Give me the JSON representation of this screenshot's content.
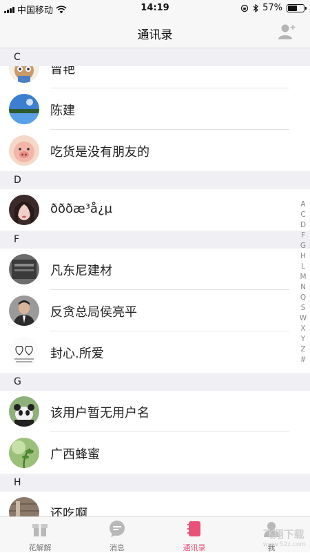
{
  "status_bar": {
    "carrier": "中国移动",
    "time": "14:19",
    "battery": "57%",
    "battery_level": 0.57
  },
  "nav": {
    "title": "通讯录",
    "add_friend_icon": "add-user-icon"
  },
  "sections": [
    {
      "letter": "C",
      "contacts": [
        {
          "name": "曾艳",
          "avatar": "cartoon-monkey"
        },
        {
          "name": "陈建",
          "avatar": "lake-landscape"
        },
        {
          "name": "吃货是没有朋友的",
          "avatar": "cartoon-pig"
        }
      ]
    },
    {
      "letter": "D",
      "contacts": [
        {
          "name": "ðððæ³å¿µ",
          "avatar": "girl-portrait"
        }
      ]
    },
    {
      "letter": "F",
      "contacts": [
        {
          "name": "凡东尼建材",
          "avatar": "dark-building"
        },
        {
          "name": "反贪总局侯亮平",
          "avatar": "man-portrait"
        },
        {
          "name": "封心.所爱",
          "avatar": "sketch-hearts"
        }
      ]
    },
    {
      "letter": "G",
      "contacts": [
        {
          "name": "该用户暂无用户名",
          "avatar": "panda"
        },
        {
          "name": "广西蜂蜜",
          "avatar": "green-plant"
        }
      ]
    },
    {
      "letter": "H",
      "contacts": [
        {
          "name": "还吃啊",
          "avatar": "wood-texture"
        }
      ]
    }
  ],
  "index_letters": [
    "A",
    "C",
    "D",
    "F",
    "G",
    "H",
    "L",
    "M",
    "N",
    "Q",
    "S",
    "W",
    "X",
    "Y",
    "Z",
    "#"
  ],
  "tabs": [
    {
      "label": "花解解",
      "icon": "gift-icon",
      "active": false
    },
    {
      "label": "消息",
      "icon": "chat-bubble-icon",
      "active": false
    },
    {
      "label": "通讯录",
      "icon": "contacts-book-icon",
      "active": true
    },
    {
      "label": "我",
      "icon": "profile-icon",
      "active": false
    }
  ],
  "colors": {
    "accent": "#e8517a",
    "section_bg": "#efeff4",
    "bar_bg": "#f7f7f7"
  },
  "watermark": {
    "text": "飞翔下载",
    "sub": "www.52z.com"
  }
}
